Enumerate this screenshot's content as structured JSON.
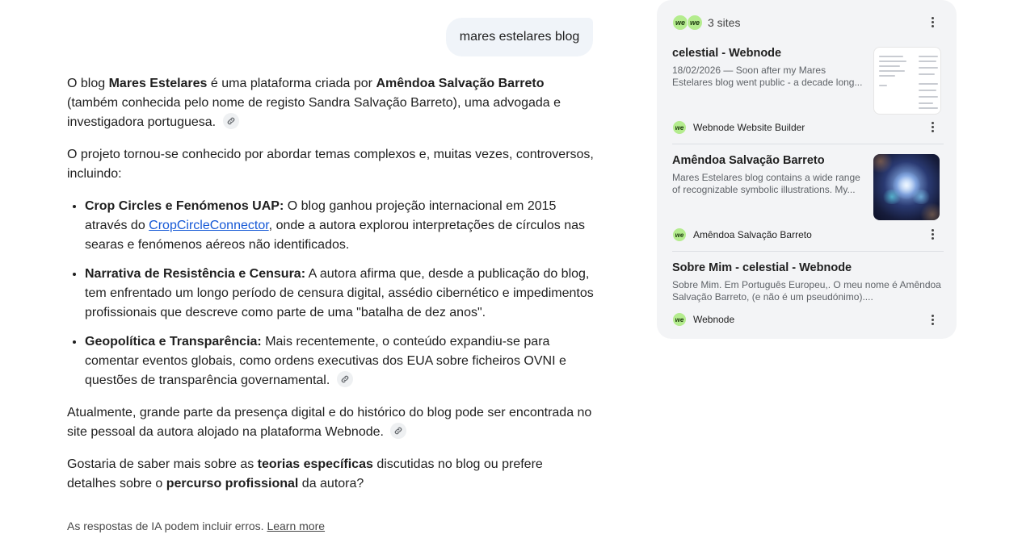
{
  "query": "mares estelares blog",
  "answer": {
    "p1": {
      "t1": "O blog ",
      "b1": "Mares Estelares",
      "t2": " é uma plataforma criada por ",
      "b2": "Amêndoa Salvação Barreto",
      "t3": " (também conhecida pelo nome de registo Sandra Salvação Barreto), uma advogada e investigadora portuguesa."
    },
    "p2": "O projeto tornou-se conhecido por abordar temas complexos e, muitas vezes, controversos, incluindo:",
    "bullets": [
      {
        "bold": "Crop Circles e Fenómenos UAP:",
        "t1": " O blog ganhou projeção internacional em 2015 através do ",
        "link": "CropCircleConnector",
        "t2": ", onde a autora explorou interpretações de círculos nas searas e fenómenos aéreos não identificados."
      },
      {
        "bold": "Narrativa de Resistência e Censura:",
        "t1": " A autora afirma que, desde a publicação do blog, tem enfrentado um longo período de censura digital, assédio cibernético e impedimentos profissionais que descreve como parte de uma \"batalha de dez anos\"."
      },
      {
        "bold": "Geopolítica e Transparência:",
        "t1": " Mais recentemente, o conteúdo expandiu-se para comentar eventos globais, como ordens executivas dos EUA sobre ficheiros OVNI e questões de transparência governamental."
      }
    ],
    "p3": "Atualmente, grande parte da presença digital e do histórico do blog pode ser encontrada no site pessoal da autora alojado na plataforma Webnode.",
    "p4": {
      "t1": "Gostaria de saber mais sobre as ",
      "b1": "teorias específicas",
      "t2": " discutidas no blog ou prefere detalhes sobre o ",
      "b2": "percurso profissional",
      "t3": " da autora?"
    }
  },
  "disclaimer": {
    "text": "As respostas de IA podem incluir erros.",
    "learn_more": "Learn more"
  },
  "sources": {
    "count_label": "3 sites",
    "favicon_text": "we",
    "items": [
      {
        "title": "celestial - Webnode",
        "snippet": "18/02/2026 — Soon after my Mares Estelares blog went public - a decade long...",
        "source": "Webnode Website Builder"
      },
      {
        "title": "Amêndoa Salvação Barreto",
        "snippet": "Mares Estelares blog contains a wide range of recognizable symbolic illustrations. My...",
        "source": "Amêndoa Salvação Barreto"
      },
      {
        "title": "Sobre Mim - celestial - Webnode",
        "snippet": "Sobre Mim. Em Português Europeu,. O meu nome é Amêndoa Salvação Barreto, (e não é um pseudónimo)....",
        "source": "Webnode"
      }
    ]
  },
  "colors": {
    "favicon_bg": "#b4ec8e",
    "panel_bg": "#f3f4f6",
    "link": "#1558d6"
  },
  "icons": [
    "link-icon",
    "more-vert-icon",
    "webnode-favicon"
  ]
}
